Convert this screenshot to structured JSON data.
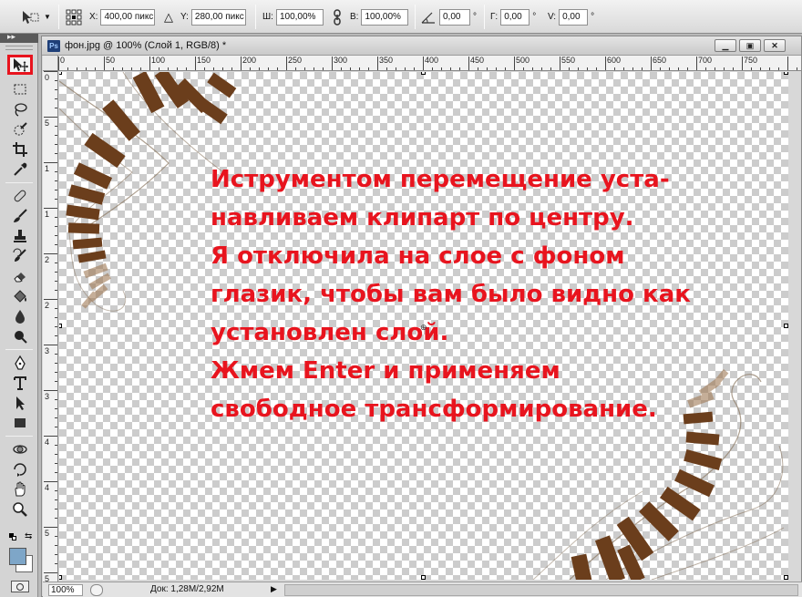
{
  "options_bar": {
    "x_label": "X:",
    "x_value": "400,00 пикс",
    "y_label": "Y:",
    "y_value": "280,00 пикс",
    "w_label": "Ш:",
    "w_value": "100,00%",
    "h_label": "В:",
    "h_value": "100,00%",
    "rotate_value": "0,00",
    "rotate_unit": "°",
    "hskew_label": "Г:",
    "hskew_value": "0,00",
    "hskew_unit": "°",
    "vskew_label": "V:",
    "vskew_value": "0,00",
    "vskew_unit": "°"
  },
  "document": {
    "app_icon": "Ps",
    "title": "фон.jpg @ 100% (Слой 1, RGB/8) *",
    "ruler_h_labels": [
      "0",
      "50",
      "100",
      "150",
      "200",
      "250",
      "300",
      "350",
      "400",
      "450",
      "500",
      "550",
      "600",
      "650",
      "700",
      "750"
    ],
    "ruler_v_labels": [
      "0",
      "5",
      "1",
      "1",
      "2",
      "2",
      "3",
      "3",
      "4",
      "4",
      "5",
      "5"
    ]
  },
  "canvas": {
    "instruction_lines": [
      "Иструментом перемещение уста-",
      "навливаем клипарт по центру.",
      "Я отключила на слое с фоном",
      "глазик, чтобы вам было видно как",
      "установлен слой.",
      "Жмем Enter и применяем",
      "свободное трансформирование."
    ],
    "instruction_color": "#e8141e"
  },
  "status": {
    "zoom": "100%",
    "doc_info": "Док: 1,28M/2,92M"
  },
  "colors": {
    "highlight": "#e8141e",
    "foreground": "#000000",
    "background": "#7ea6c8"
  },
  "tools": [
    "move-tool",
    "marquee-tool",
    "lasso-tool",
    "quick-selection-tool",
    "crop-tool",
    "eyedropper-tool",
    "healing-brush-tool",
    "brush-tool",
    "clone-stamp-tool",
    "history-brush-tool",
    "eraser-tool",
    "paint-bucket-tool",
    "blur-tool",
    "dodge-tool",
    "pen-tool",
    "type-tool",
    "path-selection-tool",
    "rectangle-tool",
    "3d-rotate-tool",
    "3d-orbit-tool",
    "hand-tool",
    "zoom-tool"
  ]
}
